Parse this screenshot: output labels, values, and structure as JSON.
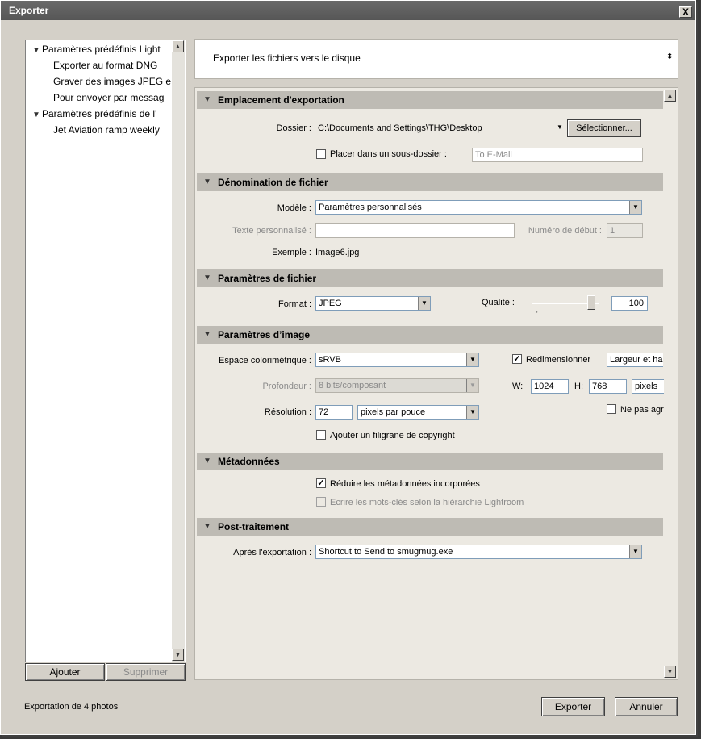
{
  "window": {
    "title": "Exporter",
    "close": "X"
  },
  "presets": {
    "groups": [
      {
        "label": "Paramètres prédéfinis Light",
        "items": [
          "Exporter au format DNG",
          "Graver des images JPEG e",
          "Pour envoyer par messag"
        ]
      },
      {
        "label": "Paramètres prédéfinis de l'",
        "items": [
          "Jet Aviation ramp weekly"
        ]
      }
    ],
    "add_label": "Ajouter",
    "remove_label": "Supprimer"
  },
  "destination": {
    "value": "Exporter les fichiers vers le disque"
  },
  "sections": {
    "location": {
      "title": "Emplacement d'exportation",
      "folder_label": "Dossier :",
      "folder_value": "C:\\Documents and Settings\\THG\\Desktop",
      "select_button": "Sélectionner...",
      "subfolder_label": "Placer dans un sous-dossier :",
      "subfolder_value": "To E-Mail"
    },
    "naming": {
      "title": "Dénomination de fichier",
      "template_label": "Modèle :",
      "template_value": "Paramètres personnalisés",
      "custom_text_label": "Texte personnalisé :",
      "custom_text_value": "",
      "start_number_label": "Numéro de début :",
      "start_number_value": "1",
      "example_label": "Exemple :",
      "example_value": "Image6.jpg"
    },
    "file_settings": {
      "title": "Paramètres de fichier",
      "format_label": "Format :",
      "format_value": "JPEG",
      "quality_label": "Qualité :",
      "quality_value": "100",
      "quality_level": 1.0
    },
    "image_settings": {
      "title": "Paramètres d’image",
      "color_space_label": "Espace colorimétrique :",
      "color_space_value": "sRVB",
      "resize_label": "Redimensionner",
      "resize_checked": true,
      "resize_mode": "Largeur et hau",
      "depth_label": "Profondeur :",
      "depth_value": "8 bits/composant",
      "w_label": "W:",
      "w_value": "1024",
      "h_label": "H:",
      "h_value": "768",
      "units_value": "pixels",
      "no_enlarge_label": "Ne pas agra",
      "resolution_label": "Résolution :",
      "resolution_value": "72",
      "resolution_units": "pixels par pouce",
      "watermark_label": "Ajouter un filigrane de copyright"
    },
    "metadata": {
      "title": "Métadonnées",
      "minimize_label": "Réduire les métadonnées incorporées",
      "minimize_checked": true,
      "keywords_label": "Ecrire les mots-clés selon la hiérarchie Lightroom"
    },
    "post": {
      "title": "Post-traitement",
      "after_label": "Après l'exportation :",
      "after_value": "Shortcut to Send to smugmug.exe"
    }
  },
  "footer": {
    "status": "Exportation de 4 photos",
    "export_button": "Exporter",
    "cancel_button": "Annuler"
  }
}
